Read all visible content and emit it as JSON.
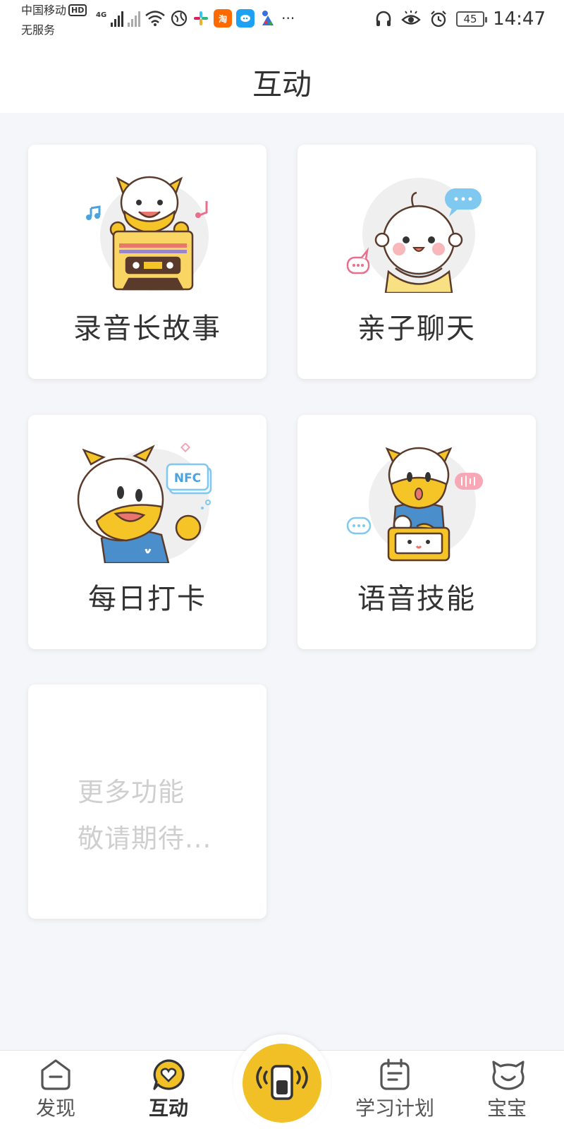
{
  "status_bar": {
    "carrier": "中国移动",
    "hd": "HD",
    "carrier_sub": "无服务",
    "network": "4G",
    "taobao_icon": "淘",
    "more_dots": "···",
    "battery": "45",
    "time": "14:47"
  },
  "header": {
    "title": "互动"
  },
  "cards": [
    {
      "label": "录音长故事",
      "icon": "cassette-tape-mascot-icon"
    },
    {
      "label": "亲子聊天",
      "icon": "baby-chat-icon"
    },
    {
      "label": "每日打卡",
      "icon": "nfc-checkin-mascot-icon"
    },
    {
      "label": "语音技能",
      "icon": "voice-skill-mascot-icon"
    }
  ],
  "more_card": {
    "line1": "更多功能",
    "line2": "敬请期待..."
  },
  "bottom_nav": {
    "items": [
      {
        "label": "发现",
        "icon": "discover-icon"
      },
      {
        "label": "互动",
        "icon": "interact-heart-icon",
        "active": true
      },
      {
        "label": "学习计划",
        "icon": "calendar-plan-icon"
      },
      {
        "label": "宝宝",
        "icon": "baby-face-icon"
      }
    ],
    "center": {
      "icon": "device-broadcast-icon"
    }
  },
  "colors": {
    "accent": "#f0c026",
    "background": "#f5f6f9",
    "mascot_blue": "#4a8fcb"
  }
}
